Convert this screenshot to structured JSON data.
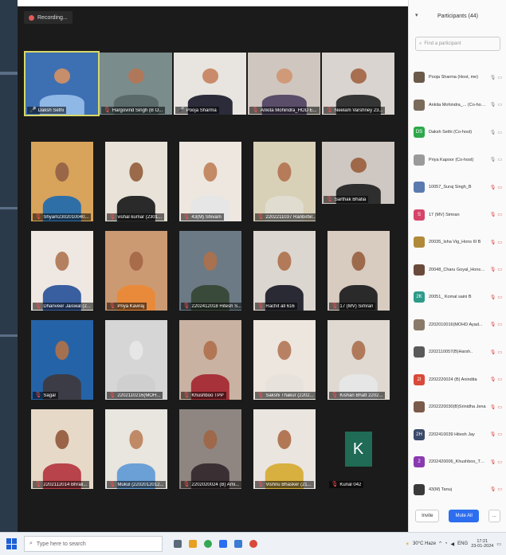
{
  "meeting": {
    "recording_label": "Recording...",
    "tiles": [
      {
        "name": "Daksh Sethi",
        "bg": "#3d6fb3",
        "skin": "#c68e6a",
        "shirt": "#8fb8e6",
        "mic": "on",
        "active": true,
        "wide": true
      },
      {
        "name": "Hargovind Singh (B O...",
        "bg": "#7a8c8c",
        "skin": "#b0785a",
        "shirt": "#5a6a6a",
        "mic": "off",
        "wide": true
      },
      {
        "name": "Pooja Sharma",
        "bg": "#e8e4e0",
        "skin": "#c98b6b",
        "shirt": "#2b2b3a",
        "mic": "on",
        "wide": true
      },
      {
        "name": "Ankita Mohindra_HOD E...",
        "bg": "#cfc7bf",
        "skin": "#d09a78",
        "shirt": "#5a4d6a",
        "mic": "off",
        "wide": true
      },
      {
        "name": "Neelam Varshney 23...",
        "bg": "#d9d4cf",
        "skin": "#a86e50",
        "shirt": "#353535",
        "mic": "off",
        "wide": true
      },
      {
        "name": "Shyam2302010040...",
        "bg": "#d8a35a",
        "skin": "#9a6648",
        "shirt": "#2f6fa8",
        "mic": "off"
      },
      {
        "name": "vishal kumar (2301...",
        "bg": "#e8e2d8",
        "skin": "#9a6a4a",
        "shirt": "#2a2a2a",
        "mic": "off"
      },
      {
        "name": "43(M) Shivam",
        "bg": "#ede7df",
        "skin": "#c48a66",
        "shirt": "#e6e6e6",
        "mic": "off"
      },
      {
        "name": "2202211037 Ranbirbir...",
        "bg": "#d9d0b8",
        "skin": "#b67c5a",
        "shirt": "#e0dccf",
        "mic": "off"
      },
      {
        "name": "Sarthak Bhatia",
        "bg": "#cfc8c2",
        "skin": "#9f6849",
        "shirt": "#2e2e2e",
        "mic": "off",
        "wide": true
      },
      {
        "name": "Dhanveer Jaiswal (2...",
        "bg": "#efe8e2",
        "skin": "#b5805f",
        "shirt": "#3a5fa0",
        "mic": "off"
      },
      {
        "name": "Priya Kaviraj",
        "bg": "#cc9a72",
        "skin": "#a86c4a",
        "shirt": "#e98a3a",
        "mic": "off"
      },
      {
        "name": "2202412018 Hitesh S...",
        "bg": "#6c7a86",
        "skin": "#a8714f",
        "shirt": "#3a4a3a",
        "mic": "off"
      },
      {
        "name": "Rachit all 616",
        "bg": "#dcd6d0",
        "skin": "#b27a58",
        "shirt": "#2a2a35",
        "mic": "off"
      },
      {
        "name": "17 (MV) Simran",
        "bg": "#d8cbc0",
        "skin": "#9e6a4c",
        "shirt": "#2a2a2a",
        "mic": "off"
      },
      {
        "name": "Sagar",
        "bg": "#2563a8",
        "skin": "#a57050",
        "shirt": "#3c3c46",
        "mic": "off"
      },
      {
        "name": "2202110216(MOH...",
        "bg": "#d6d6d6",
        "skin": "#e6e6e6",
        "shirt": "#cfcfcf",
        "mic": "off"
      },
      {
        "name": "Khushboo TPP",
        "bg": "#c9b2a2",
        "skin": "#b27654",
        "shirt": "#a8323a",
        "mic": "off"
      },
      {
        "name": "Sakshi Thakur (2202...",
        "bg": "#ece6df",
        "skin": "#b98163",
        "shirt": "#e7e2db",
        "mic": "off"
      },
      {
        "name": "Kishan Bhatt 2202...",
        "bg": "#dfd9d2",
        "skin": "#b07a5a",
        "shirt": "#e6e6e6",
        "mic": "off"
      },
      {
        "name": "2202112014 Bhrali...",
        "bg": "#e7d9c8",
        "skin": "#9a6448",
        "shirt": "#b8434a",
        "mic": "off"
      },
      {
        "name": "Mukul (2202012012...",
        "bg": "#e9e5df",
        "skin": "#c08a66",
        "shirt": "#6aa0d6",
        "mic": "off"
      },
      {
        "name": "2202020024 (B) Ami...",
        "bg": "#8f8682",
        "skin": "#9e684a",
        "shirt": "#3a3034",
        "mic": "off"
      },
      {
        "name": "Vishnu Bhasker (21...",
        "bg": "#ebe5df",
        "skin": "#b27856",
        "shirt": "#d8b040",
        "mic": "off"
      },
      {
        "name": "Kunal 042",
        "avatar_letter": "K",
        "avatar_color": "#1f6b55",
        "mic": "off"
      }
    ]
  },
  "panel": {
    "title": "Participants (44)",
    "search_placeholder": "Find a participant",
    "invite_label": "Invite",
    "mute_all_label": "Mute All",
    "more_label": "...",
    "participants": [
      {
        "name": "Pooja Sharma (Host, me)",
        "color": "#6b5a4a",
        "icons": "video"
      },
      {
        "name": "Ankita Mohindra_... (Co-host)",
        "color": "#7a6a5a",
        "icons": "video"
      },
      {
        "name": "Daksh Sethi (Co-host)",
        "initials": "DS",
        "color": "#2ea84a",
        "icons": "video"
      },
      {
        "name": "Priya Kapoor (Co-host)",
        "color": "#9a9a9a",
        "icons": "video"
      },
      {
        "name": "10057_Suraj Singh_B",
        "color": "#5a7ab0",
        "icons": "muted"
      },
      {
        "name": "17 (MV) Simran",
        "initials": "S",
        "color": "#d6446a",
        "icons": "muted"
      },
      {
        "name": "20035_Isha Vig_Hons III B",
        "color": "#b08a3a",
        "icons": "muted"
      },
      {
        "name": "20048_Charu Goyal_Hons _ II",
        "color": "#6a4a3a",
        "icons": "muted"
      },
      {
        "name": "20051_ Komal saini B",
        "initials": "2K",
        "color": "#2e9a8a",
        "icons": "muted"
      },
      {
        "name": "2202010016(MOHD Ayad...",
        "color": "#8a7a6a",
        "icons": "muted"
      },
      {
        "name": "2202110057(B)Harsh..",
        "color": "#5a5a5a",
        "icons": "muted"
      },
      {
        "name": "2202220024 (B) Anindita",
        "initials": "2I",
        "color": "#d84a3a",
        "icons": "muted"
      },
      {
        "name": "2202220030(B)Srinidha Jena",
        "color": "#7a5a4a",
        "icons": "muted"
      },
      {
        "name": "2202410039 Hitesh Jay",
        "initials": "2H",
        "color": "#3a4a6a",
        "icons": "muted"
      },
      {
        "name": "2202420006_Khushboo_TPP",
        "initials": "2",
        "color": "#8a3ab0",
        "icons": "muted"
      },
      {
        "name": "43(M) Tanuj",
        "color": "#3a3a3a",
        "icons": "muted"
      }
    ]
  },
  "taskbar": {
    "search_placeholder": "Type here to search",
    "weather": "30°C Haze",
    "lang": "ENG",
    "time": "17:21",
    "date": "23-01-2024"
  }
}
